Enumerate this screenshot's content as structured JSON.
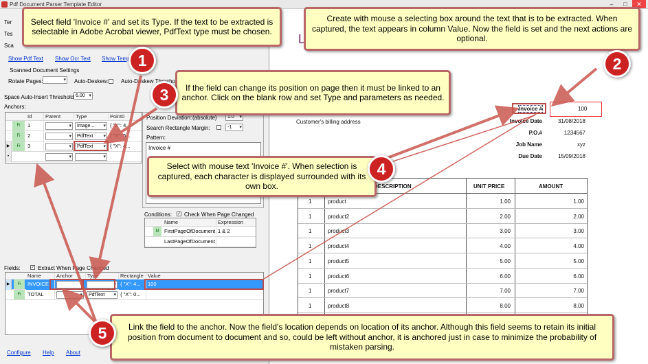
{
  "window": {
    "title": "Pdf Document Parser Template Editor",
    "min": "–",
    "max": "□",
    "close": "✕"
  },
  "left": {
    "cut_labels": [
      "Ter",
      "Tes",
      "Sca"
    ],
    "links": [
      "Show Pdf Text",
      "Show Ocr Text",
      "Show Temp"
    ],
    "scanned_title": "Scanned Document Settings",
    "rotate_label": "Rotate Pages:",
    "auto_deskew": "Auto-Deskew:",
    "auto_deskew_threshold": "Auto-Deskew Threshold",
    "space_label": "Space Auto-Insert Threshold:",
    "space_value": "6.00",
    "anchors_label": "Anchors:"
  },
  "anchors": {
    "headers": [
      "Id",
      "Parent",
      "Type",
      "Point0"
    ],
    "rows": [
      {
        "id": "1",
        "type": "Image...",
        "point": "{ \"X\": 4..."
      },
      {
        "id": "2",
        "type": "PdfText",
        "point": "{ \"X\": 5..."
      },
      {
        "id": "3",
        "type": "PdfText",
        "point": "{ \"X\": 4..."
      }
    ],
    "new_row_marker": "•"
  },
  "props": {
    "pos_dev": "Position Deviation:",
    "pos_dev_mode": "(absolute)",
    "pos_dev_val": "1.0",
    "search_margin": "Search Rectangle Margin:",
    "search_margin_val": "-1",
    "pattern": "Pattern:",
    "pattern_value": "Invoice #"
  },
  "conditions": {
    "label": "Conditions:",
    "check_label": "Check When Page Changed",
    "headers": [
      "Name",
      "Expression"
    ],
    "rows": [
      {
        "marker": "M",
        "name": "FirstPageOfDocument",
        "expr": "1 & 2"
      },
      {
        "marker": "",
        "name": "LastPageOfDocument",
        "expr": ""
      }
    ]
  },
  "fields": {
    "label": "Fields:",
    "check_label": "Extract When Page Changed",
    "headers": [
      "Name",
      "Anchor",
      "Type",
      "Rectangle",
      "Value"
    ],
    "rows": [
      {
        "name": "INVOICE",
        "anchor": "3",
        "type": "PdfText",
        "rect": "{ \"X\": 4...",
        "value": "100"
      },
      {
        "name": "TOTAL",
        "anchor": "",
        "type": "PdfText",
        "rect": "{ \"X\": 0...",
        "value": ""
      }
    ]
  },
  "footer_links": [
    "Configure",
    "Help",
    "About"
  ],
  "doc": {
    "letter": "L",
    "invoice_label": "Invoice #",
    "invoice_value": "100",
    "billing": "Customer's billing address",
    "info": [
      {
        "k": "Invoice Date",
        "v": "31/08/2018"
      },
      {
        "k": "P.O.#",
        "v": "1234567"
      },
      {
        "k": "Job Name",
        "v": "xyz"
      },
      {
        "k": "Due Date",
        "v": "15/09/2018"
      }
    ],
    "table_headers": [
      "DESCRIPTION",
      "UNIT PRICE",
      "AMOUNT"
    ],
    "items": [
      {
        "qty": "1",
        "desc": "product",
        "unit": "1.00",
        "amount": "1.00"
      },
      {
        "qty": "1",
        "desc": "product2",
        "unit": "2.00",
        "amount": "2.00"
      },
      {
        "qty": "1",
        "desc": "product3",
        "unit": "3.00",
        "amount": "3.00"
      },
      {
        "qty": "1",
        "desc": "product4",
        "unit": "4.00",
        "amount": "4.00"
      },
      {
        "qty": "1",
        "desc": "product5",
        "unit": "5.00",
        "amount": "5.00"
      },
      {
        "qty": "1",
        "desc": "product6",
        "unit": "6.00",
        "amount": "6.00"
      },
      {
        "qty": "1",
        "desc": "product7",
        "unit": "7.00",
        "amount": "7.00"
      },
      {
        "qty": "1",
        "desc": "product8",
        "unit": "8.00",
        "amount": "8.00"
      }
    ]
  },
  "callouts": {
    "c1": "Select field 'Invoice #' and set its Type. If the text to be extracted is selectable in Adobe Acrobat viewer, PdfText type must be chosen.",
    "c2": "Create with mouse a selecting box around the text that is to be extracted. When captured, the text appears in column Value. Now the field is set and the next actions are optional.",
    "c3": "If the field can change its position on page then it must be linked to an anchor. Click on the blank row and set Type and parameters as needed.",
    "c4": "Select with mouse text 'Invoice #'. When selection is captured, each character is displayed surrounded with its own box.",
    "c5": "Link the field to the anchor. Now the field's location depends on location of its anchor. Although this field seems to retain its initial position from document to document and so, could be left without anchor, it is anchored just in case to minimize the probability of mistaken parsing."
  },
  "steps": [
    "1",
    "2",
    "3",
    "4",
    "5"
  ],
  "colors": {
    "accent": "#3399ff",
    "callout_bg": "#ffffc2",
    "callout_border": "#b86666",
    "step": "#cc2222"
  }
}
